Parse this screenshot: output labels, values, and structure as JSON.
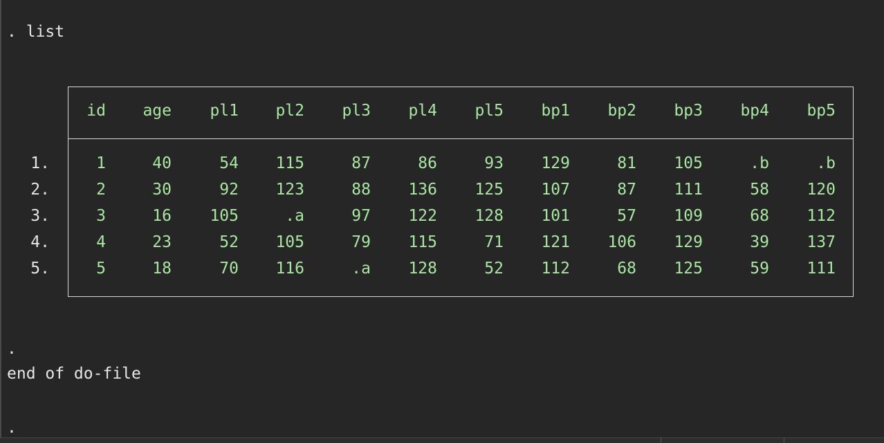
{
  "console": {
    "command": ". list",
    "prompt_dot": ".",
    "end_message": "end of do-file",
    "final_prompt": "."
  },
  "table": {
    "columns": [
      "id",
      "age",
      "pl1",
      "pl2",
      "pl3",
      "pl4",
      "pl5",
      "bp1",
      "bp2",
      "bp3",
      "bp4",
      "bp5"
    ],
    "row_labels": [
      "1.",
      "2.",
      "3.",
      "4.",
      "5."
    ],
    "rows": [
      [
        "1",
        "40",
        "54",
        "115",
        "87",
        "86",
        "93",
        "129",
        "81",
        "105",
        ".b",
        ".b"
      ],
      [
        "2",
        "30",
        "92",
        "123",
        "88",
        "136",
        "125",
        "107",
        "87",
        "111",
        "58",
        "120"
      ],
      [
        "3",
        "16",
        "105",
        ".a",
        "97",
        "122",
        "128",
        "101",
        "57",
        "109",
        "68",
        "112"
      ],
      [
        "4",
        "23",
        "52",
        "105",
        "79",
        "115",
        "71",
        "121",
        "106",
        "129",
        "39",
        "137"
      ],
      [
        "5",
        "18",
        "70",
        "116",
        ".a",
        "128",
        "52",
        "112",
        "68",
        "125",
        "59",
        "111"
      ]
    ]
  },
  "colors": {
    "background": "#262626",
    "text": "#e6e6e6",
    "values": "#a9e6a2",
    "border": "#d9d9d9"
  }
}
